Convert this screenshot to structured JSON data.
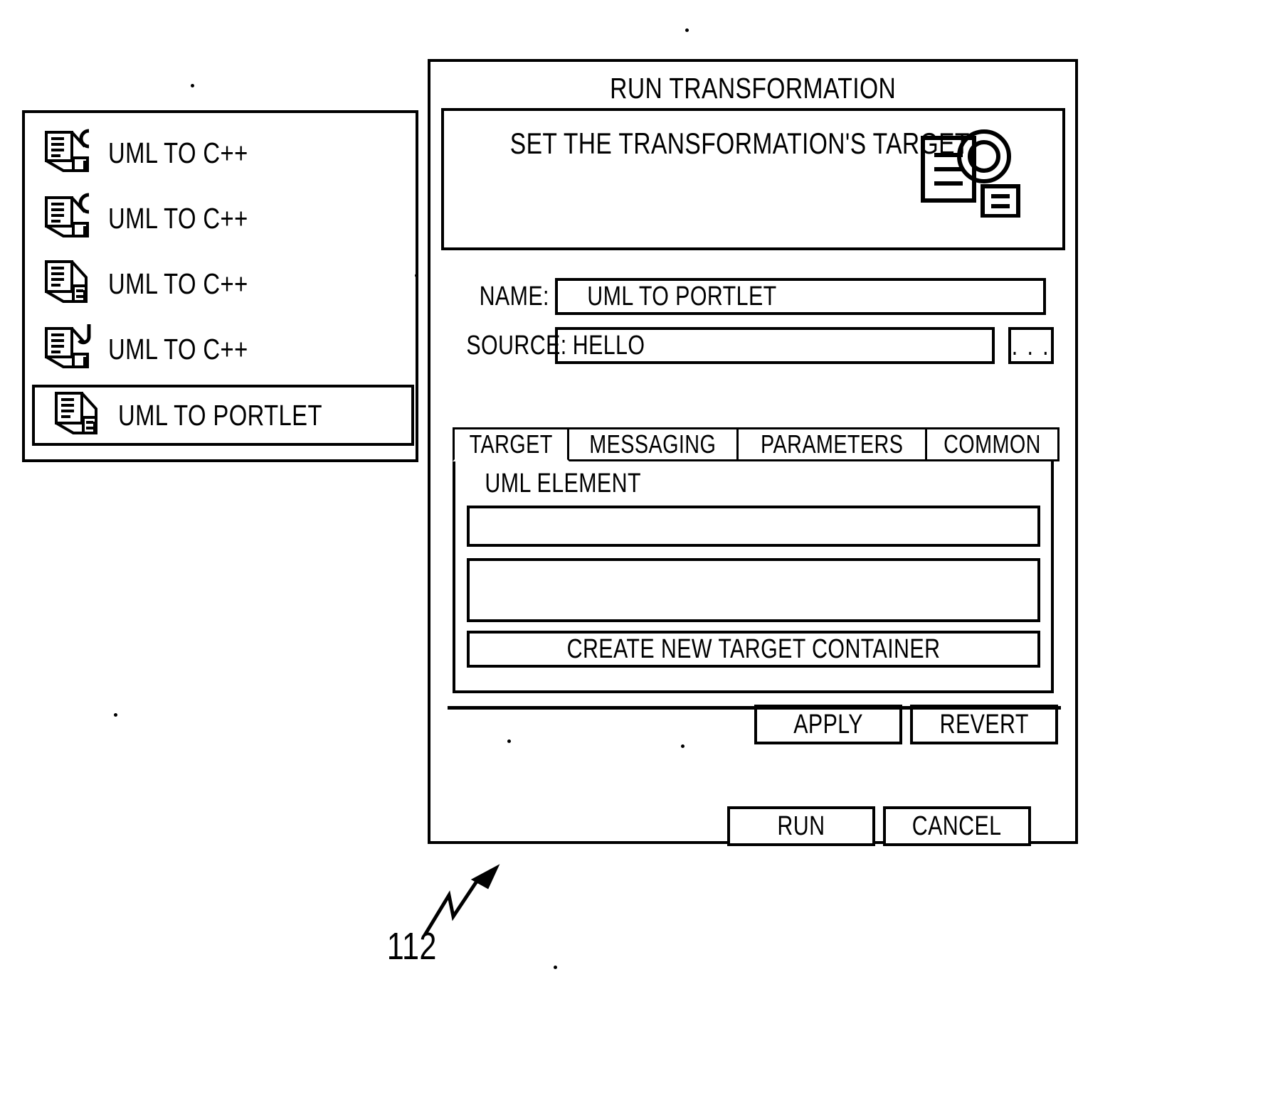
{
  "figure": {
    "callout_number": "112"
  },
  "transformation_list": {
    "name": "transformation-list",
    "items": [
      {
        "label": "UML TO C++",
        "icon": "uml-to-cpp-icon",
        "selected": false
      },
      {
        "label": "UML TO C++",
        "icon": "uml-to-cpp-icon",
        "selected": false
      },
      {
        "label": "UML TO C++",
        "icon": "uml-to-doc-icon",
        "selected": false
      },
      {
        "label": "UML TO C++",
        "icon": "uml-to-java-icon",
        "selected": false
      },
      {
        "label": "UML TO PORTLET",
        "icon": "uml-to-portlet-icon",
        "selected": true
      }
    ]
  },
  "dialog": {
    "title": "RUN TRANSFORMATION",
    "banner": {
      "heading": "SET THE TRANSFORMATION'S TARGET",
      "icon": "transformation-banner-icon"
    },
    "fields": {
      "name_label": "NAME:",
      "name_value": "UML TO PORTLET",
      "source_label": "SOURCE:",
      "source_value": "HELLO",
      "browse_label": ". . ."
    },
    "tabs": [
      {
        "label": "TARGET",
        "active": true
      },
      {
        "label": "MESSAGING",
        "active": false
      },
      {
        "label": "PARAMETERS",
        "active": false
      },
      {
        "label": "COMMON",
        "active": false
      }
    ],
    "target_tab": {
      "uml_element_label": "UML ELEMENT",
      "uml_element_value": "",
      "target_container_value": "",
      "create_button_label": "CREATE NEW TARGET CONTAINER"
    },
    "form_buttons": {
      "apply_label": "APPLY",
      "revert_label": "REVERT"
    },
    "dialog_buttons": {
      "run_label": "RUN",
      "cancel_label": "CANCEL"
    }
  }
}
